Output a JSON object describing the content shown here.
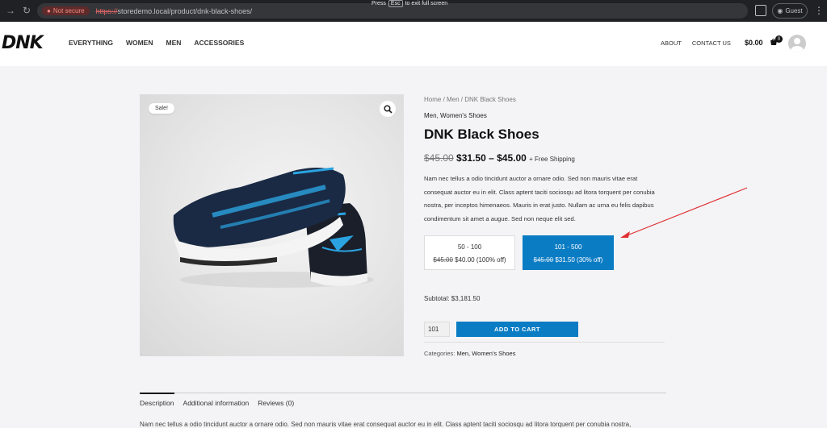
{
  "browser": {
    "security_label": "Not secure",
    "url_scheme": "https://",
    "url_rest": "storedemo.local/product/dnk-black-shoes/",
    "fullscreen_press": "Press",
    "fullscreen_key": "Esc",
    "fullscreen_hint": "to exit full screen",
    "profile_label": "Guest"
  },
  "site": {
    "logo": "DNK",
    "nav": [
      "EVERYTHING",
      "WOMEN",
      "MEN",
      "ACCESSORIES"
    ],
    "right_nav": [
      "ABOUT",
      "CONTACT US"
    ],
    "cart_total": "$0.00",
    "cart_count": "0"
  },
  "product": {
    "sale_badge": "Sale!",
    "breadcrumb": "Home / Men / DNK Black Shoes",
    "categories_top": "Men, Women's Shoes",
    "title": "DNK Black Shoes",
    "price_old": "$45.00",
    "price_range": "$31.50 – $45.00",
    "shipping": "+ Free Shipping",
    "description": "Nam nec tellus a odio tincidunt auctor a ornare odio. Sed non mauris vitae erat consequat auctor eu in elit. Class aptent taciti sociosqu ad litora torquent per conubia nostra, per inceptos himenaeos. Mauris in erat justo. Nullam ac urna eu felis dapibus condimentum sit amet a augue. Sed non neque elit sed.",
    "tiers": [
      {
        "range": "50 - 100",
        "old": "$45.00",
        "new": "$40.00 (100% off)"
      },
      {
        "range": "101 - 500",
        "old": "$45.00",
        "new": "$31.50 (30% off)"
      }
    ],
    "subtotal": "Subtotal: $3,181.50",
    "quantity": "101",
    "add_to_cart": "ADD TO CART",
    "categories_label": "Categories:",
    "categories_value": "Men, Women's Shoes"
  },
  "tabs": {
    "items": [
      "Description",
      "Additional information",
      "Reviews (0)"
    ],
    "description_preview": "Nam nec tellus a odio tincidunt auctor a ornare odio. Sed non mauris vitae erat consequat auctor eu in elit. Class aptent taciti sociosqu ad litora torquent per conubia nostra,"
  },
  "colors": {
    "accent": "#0a7cc4",
    "annotation_arrow": "#e03030"
  }
}
